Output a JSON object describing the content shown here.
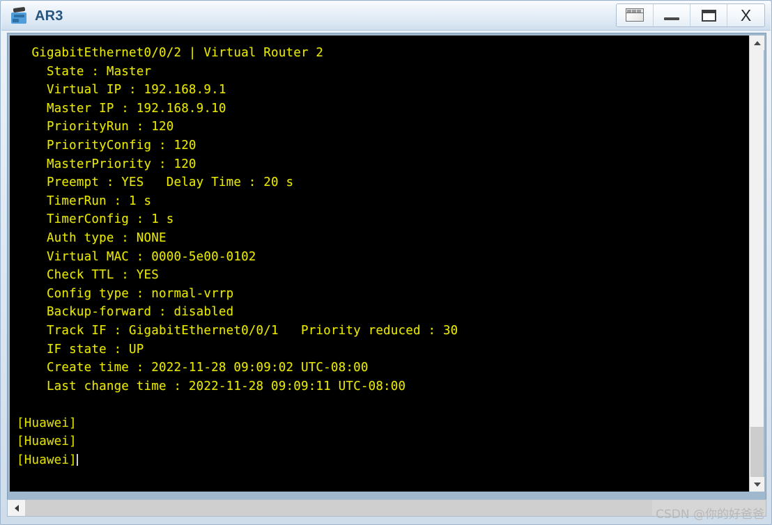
{
  "window": {
    "title": "AR3",
    "app_icon": "router-icon",
    "controls": [
      {
        "name": "restore-window-button",
        "icon": "restore-icon",
        "label": ""
      },
      {
        "name": "minimize-window-button",
        "icon": "minimize-icon",
        "label": ""
      },
      {
        "name": "maximize-window-button",
        "icon": "maximize-icon",
        "label": ""
      },
      {
        "name": "close-window-button",
        "icon": "close-icon",
        "label": "X"
      }
    ]
  },
  "terminal": {
    "foreground_color": "#e8e800",
    "background_color": "#000000",
    "output": "  GigabitEthernet0/0/2 | Virtual Router 2\n    State : Master\n    Virtual IP : 192.168.9.1\n    Master IP : 192.168.9.10\n    PriorityRun : 120\n    PriorityConfig : 120\n    MasterPriority : 120\n    Preempt : YES   Delay Time : 20 s\n    TimerRun : 1 s\n    TimerConfig : 1 s\n    Auth type : NONE\n    Virtual MAC : 0000-5e00-0102\n    Check TTL : YES\n    Config type : normal-vrrp\n    Backup-forward : disabled\n    Track IF : GigabitEthernet0/0/1   Priority reduced : 30\n    IF state : UP\n    Create time : 2022-11-28 09:09:02 UTC-08:00\n    Last change time : 2022-11-28 09:09:11 UTC-08:00\n\n",
    "prompt_lines": [
      "[Huawei]",
      "[Huawei]",
      "[Huawei]"
    ],
    "vrrp": {
      "interface": "GigabitEthernet0/0/2",
      "virtual_router": "Virtual Router 2",
      "state_label": "State",
      "state": "Master",
      "virtual_ip_label": "Virtual IP",
      "virtual_ip": "192.168.9.1",
      "master_ip_label": "Master IP",
      "master_ip": "192.168.9.10",
      "priority_run_label": "PriorityRun",
      "priority_run": "120",
      "priority_config_label": "PriorityConfig",
      "priority_config": "120",
      "master_priority_label": "MasterPriority",
      "master_priority": "120",
      "preempt_label": "Preempt",
      "preempt": "YES",
      "delay_time_label": "Delay Time",
      "delay_time": "20 s",
      "timer_run_label": "TimerRun",
      "timer_run": "1 s",
      "timer_config_label": "TimerConfig",
      "timer_config": "1 s",
      "auth_type_label": "Auth type",
      "auth_type": "NONE",
      "virtual_mac_label": "Virtual MAC",
      "virtual_mac": "0000-5e00-0102",
      "check_ttl_label": "Check TTL",
      "check_ttl": "YES",
      "config_type_label": "Config type",
      "config_type": "normal-vrrp",
      "backup_forward_label": "Backup-forward",
      "backup_forward": "disabled",
      "track_if_label": "Track IF",
      "track_if": "GigabitEthernet0/0/1",
      "priority_reduced_label": "Priority reduced",
      "priority_reduced": "30",
      "if_state_label": "IF state",
      "if_state": "UP",
      "create_time_label": "Create time",
      "create_time": "2022-11-28 09:09:02 UTC-08:00",
      "last_change_time_label": "Last change time",
      "last_change_time": "2022-11-28 09:09:11 UTC-08:00"
    }
  },
  "scrollbars": {
    "vertical": {
      "up_icon": "chevron-up-icon",
      "down_icon": "chevron-down-icon"
    },
    "horizontal": {
      "left_icon": "chevron-left-icon"
    }
  },
  "watermark": {
    "text": "CSDN @你的好爸爸"
  }
}
